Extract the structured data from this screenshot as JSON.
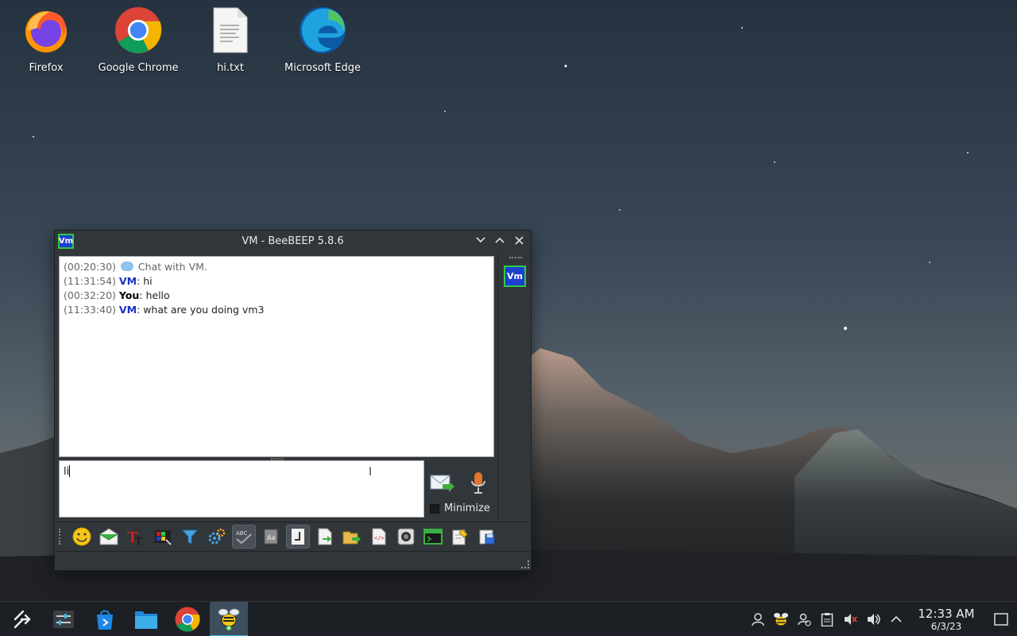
{
  "desktop": {
    "icons": [
      {
        "label": "Firefox"
      },
      {
        "label": "Google Chrome"
      },
      {
        "label": "hi.txt"
      },
      {
        "label": "Microsoft Edge"
      }
    ]
  },
  "window": {
    "title": "VM - BeeBEEP 5.8.6",
    "app_icon_text": "Vm",
    "chat": [
      {
        "time": "(00:20:30)",
        "text": "Chat with VM."
      },
      {
        "time": "(11:31:54)",
        "sender": "VM",
        "text": ": hi"
      },
      {
        "time": "(00:32:20)",
        "sender": "You",
        "text": ": hello"
      },
      {
        "time": "(11:33:40)",
        "sender": "VM",
        "text": ": what are you doing vm3"
      }
    ],
    "sidebar_user": "Vm",
    "input_value": "li",
    "minimize_label": "Minimize"
  },
  "taskbar": {
    "clock_time": "12:33 AM",
    "clock_date": "6/3/23"
  },
  "colors": {
    "accent": "#3daee9",
    "vm_name": "#1a2fc4",
    "avatar_bg": "#1d3fd2",
    "avatar_border": "#2ecc40"
  }
}
